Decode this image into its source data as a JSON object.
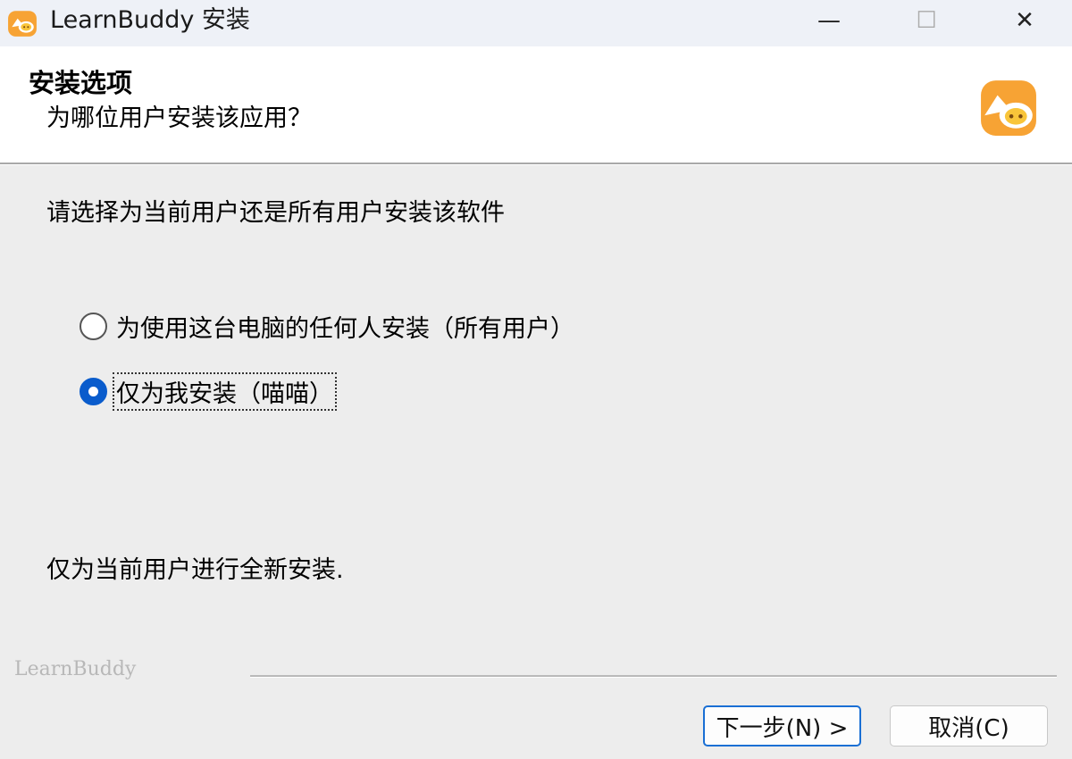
{
  "window": {
    "title": "LearnBuddy 安装",
    "minimize_glyph": "—",
    "maximize_glyph": "☐",
    "close_glyph": "✕"
  },
  "header": {
    "title": "安装选项",
    "subtitle": "为哪位用户安装该应用？",
    "logo_icon": "learnbuddy-logo-icon"
  },
  "body": {
    "instruction": "请选择为当前用户还是所有用户安装该软件",
    "options": [
      {
        "label": "为使用这台电脑的任何人安装（所有用户）",
        "selected": false
      },
      {
        "label": "仅为我安装（喵喵）",
        "selected": true
      }
    ],
    "status": "仅为当前用户进行全新安装."
  },
  "footer": {
    "brand": "LearnBuddy",
    "next_label": "下一步(N) >",
    "cancel_label": "取消(C)"
  },
  "colors": {
    "accent": "#0a5ccc",
    "logo_orange": "#f7a334",
    "logo_yellow": "#f9c53a"
  }
}
